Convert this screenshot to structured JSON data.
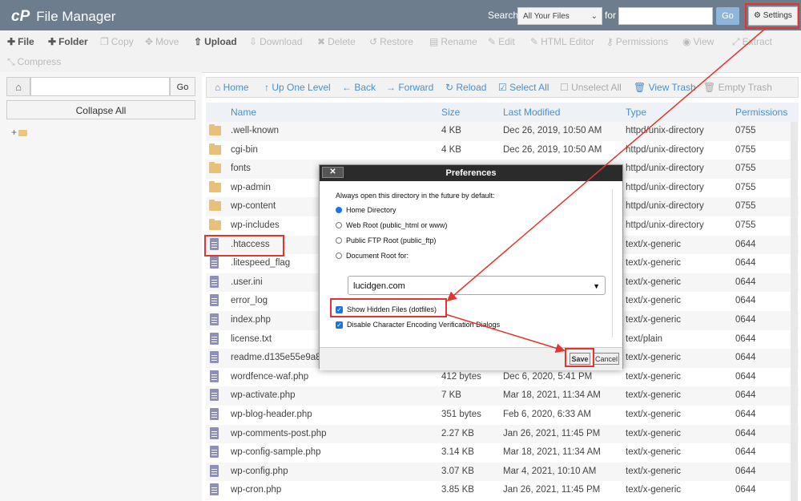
{
  "header": {
    "logo_mark": "cP",
    "app_title": "File Manager",
    "search_label": "Search",
    "search_scope": "All Your Files",
    "for_label": "for",
    "search_value": "",
    "go_label": "Go",
    "settings_label": "Settings"
  },
  "toolbar": {
    "items": [
      {
        "label": "File",
        "icon": "plus-icon",
        "enabled": true
      },
      {
        "label": "Folder",
        "icon": "plus-icon",
        "enabled": true
      },
      {
        "label": "Copy",
        "icon": "copy-icon",
        "enabled": false
      },
      {
        "label": "Move",
        "icon": "move-icon",
        "enabled": false
      },
      {
        "label": "Upload",
        "icon": "upload-icon",
        "enabled": true
      },
      {
        "label": "Download",
        "icon": "download-icon",
        "enabled": false
      },
      {
        "label": "Delete",
        "icon": "close-icon",
        "enabled": false
      },
      {
        "label": "Restore",
        "icon": "undo-icon",
        "enabled": false
      },
      {
        "label": "Rename",
        "icon": "rename-icon",
        "enabled": false
      },
      {
        "label": "Edit",
        "icon": "pencil-icon",
        "enabled": false
      },
      {
        "label": "HTML Editor",
        "icon": "html-icon",
        "enabled": false
      },
      {
        "label": "Permissions",
        "icon": "key-icon",
        "enabled": false
      },
      {
        "label": "View",
        "icon": "eye-icon",
        "enabled": false
      },
      {
        "label": "Extract",
        "icon": "extract-icon",
        "enabled": false
      },
      {
        "label": "Compress",
        "icon": "compress-icon",
        "enabled": false
      }
    ]
  },
  "sidebar": {
    "go_label": "Go",
    "path_value": "",
    "collapse_label": "Collapse All",
    "tree_expand": "+"
  },
  "nav": {
    "items": [
      {
        "label": "Home",
        "icon": "home-icon",
        "enabled": true
      },
      {
        "label": "Up One Level",
        "icon": "arrow-up-icon",
        "enabled": true
      },
      {
        "label": "Back",
        "icon": "arrow-left-icon",
        "enabled": true
      },
      {
        "label": "Forward",
        "icon": "arrow-right-icon",
        "enabled": true
      },
      {
        "label": "Reload",
        "icon": "reload-icon",
        "enabled": true
      },
      {
        "label": "Select All",
        "icon": "checkbox-checked-icon",
        "enabled": true
      },
      {
        "label": "Unselect All",
        "icon": "checkbox-empty-icon",
        "enabled": false
      },
      {
        "label": "View Trash",
        "icon": "trash-icon",
        "enabled": true
      },
      {
        "label": "Empty Trash",
        "icon": "trash-icon",
        "enabled": false
      }
    ]
  },
  "table": {
    "columns": [
      "Name",
      "Size",
      "Last Modified",
      "Type",
      "Permissions"
    ],
    "rows": [
      {
        "kind": "folder",
        "name": ".well-known",
        "size": "4 KB",
        "modified": "Dec 26, 2019, 10:50 AM",
        "type": "httpd/unix-directory",
        "perms": "0755"
      },
      {
        "kind": "folder",
        "name": "cgi-bin",
        "size": "4 KB",
        "modified": "Dec 26, 2019, 10:50 AM",
        "type": "httpd/unix-directory",
        "perms": "0755"
      },
      {
        "kind": "folder",
        "name": "fonts",
        "size": "",
        "modified": "",
        "type": "httpd/unix-directory",
        "perms": "0755"
      },
      {
        "kind": "folder",
        "name": "wp-admin",
        "size": "",
        "modified": "",
        "type": "httpd/unix-directory",
        "perms": "0755"
      },
      {
        "kind": "folder",
        "name": "wp-content",
        "size": "",
        "modified": "",
        "type": "httpd/unix-directory",
        "perms": "0755"
      },
      {
        "kind": "folder",
        "name": "wp-includes",
        "size": "",
        "modified": "",
        "type": "httpd/unix-directory",
        "perms": "0755"
      },
      {
        "kind": "file",
        "name": ".htaccess",
        "size": "",
        "modified": "",
        "type": "text/x-generic",
        "perms": "0644"
      },
      {
        "kind": "file",
        "name": ".litespeed_flag",
        "size": "",
        "modified": "",
        "type": "text/x-generic",
        "perms": "0644"
      },
      {
        "kind": "file",
        "name": ".user.ini",
        "size": "",
        "modified": "",
        "type": "text/x-generic",
        "perms": "0644"
      },
      {
        "kind": "file",
        "name": "error_log",
        "size": "",
        "modified": "",
        "type": "text/x-generic",
        "perms": "0644"
      },
      {
        "kind": "file",
        "name": "index.php",
        "size": "",
        "modified": "",
        "type": "text/x-generic",
        "perms": "0644"
      },
      {
        "kind": "file",
        "name": "license.txt",
        "size": "",
        "modified": "",
        "type": "text/plain",
        "perms": "0644"
      },
      {
        "kind": "file",
        "name": "readme.d135e55e9a8a",
        "size": "",
        "modified": "",
        "type": "text/x-generic",
        "perms": "0644"
      },
      {
        "kind": "file",
        "name": "wordfence-waf.php",
        "size": "412 bytes",
        "modified": "Dec 6, 2020, 5:41 PM",
        "type": "text/x-generic",
        "perms": "0644"
      },
      {
        "kind": "file",
        "name": "wp-activate.php",
        "size": "7 KB",
        "modified": "Mar 18, 2021, 11:34 AM",
        "type": "text/x-generic",
        "perms": "0644"
      },
      {
        "kind": "file",
        "name": "wp-blog-header.php",
        "size": "351 bytes",
        "modified": "Feb 6, 2020, 6:33 AM",
        "type": "text/x-generic",
        "perms": "0644"
      },
      {
        "kind": "file",
        "name": "wp-comments-post.php",
        "size": "2.27 KB",
        "modified": "Jan 26, 2021, 11:45 PM",
        "type": "text/x-generic",
        "perms": "0644"
      },
      {
        "kind": "file",
        "name": "wp-config-sample.php",
        "size": "3.14 KB",
        "modified": "Mar 18, 2021, 11:34 AM",
        "type": "text/x-generic",
        "perms": "0644"
      },
      {
        "kind": "file",
        "name": "wp-config.php",
        "size": "3.07 KB",
        "modified": "Mar 4, 2021, 10:10 AM",
        "type": "text/x-generic",
        "perms": "0644"
      },
      {
        "kind": "file",
        "name": "wp-cron.php",
        "size": "3.85 KB",
        "modified": "Jan 26, 2021, 11:45 PM",
        "type": "text/x-generic",
        "perms": "0644"
      }
    ]
  },
  "dialog": {
    "title": "Preferences",
    "close_label": "✕",
    "question": "Always open this directory in the future by default:",
    "options": [
      {
        "label": "Home Directory",
        "selected": true
      },
      {
        "label": "Web Root (public_html or www)",
        "selected": false
      },
      {
        "label": "Public FTP Root (public_ftp)",
        "selected": false
      },
      {
        "label": "Document Root for:",
        "selected": false
      }
    ],
    "domain": "lucidgen.com",
    "show_hidden_label": "Show Hidden Files (dotfiles)",
    "show_hidden_checked": true,
    "disable_encoding_label": "Disable Character Encoding Verification Dialogs",
    "disable_encoding_checked": true,
    "save_label": "Save",
    "cancel_label": "Cancel"
  },
  "colors": {
    "header_bg": "#6d7d8e",
    "accent_blue": "#4a8fd0",
    "highlight_red": "#e3342f",
    "folder": "#e8c07a",
    "file": "#8d8fb6"
  }
}
